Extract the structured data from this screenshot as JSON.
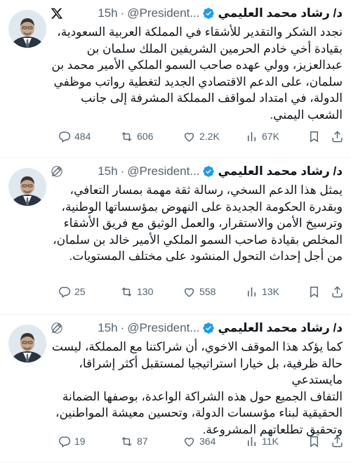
{
  "tweets": [
    {
      "author": {
        "name": "د/ رشاد محمد العليمي",
        "handle": "@President...",
        "time": "15h"
      },
      "show_x_logo": true,
      "show_edited": false,
      "paragraphs": [
        "نجدد الشكر والتقدير للأشقاء في المملكة العربية السعودية، بقيادة أخي خادم الحرمين الشريفين الملك سلمان بن عبدالعزيز، وولي عهده صاحب السمو الملكي الأمير محمد بن سلمان، على الدعم الاقتصادي الجديد لتغطية رواتب موظفي الدولة، في امتداد لمواقف المملكة المشرفة إلى جانب الشعب اليمني."
      ],
      "stats": {
        "replies": "484",
        "reposts": "606",
        "likes": "2.2K",
        "views": "67K"
      }
    },
    {
      "author": {
        "name": "د/ رشاد محمد العليمي",
        "handle": "@President...",
        "time": "15h"
      },
      "show_x_logo": false,
      "show_edited": true,
      "paragraphs": [
        "يمثل هذا الدعم السخي، رسالة ثقة مهمة بمسار التعافي، وبقدرة الحكومة الجديدة على النهوض بمؤسساتها الوطنية، وترسيخ الأمن والاستقرار، والعمل الوثيق مع فريق الأشقاء المخلص بقيادة صاحب السمو الملكي الأمير خالد بن سلمان، من أجل إحداث التحول المنشود على مختلف المستويات."
      ],
      "stats": {
        "replies": "25",
        "reposts": "130",
        "likes": "558",
        "views": "13K"
      }
    },
    {
      "author": {
        "name": "د/ رشاد محمد العليمي",
        "handle": "@President...",
        "time": "15h"
      },
      "show_x_logo": false,
      "show_edited": true,
      "paragraphs": [
        "كما يؤكد هذا الموقف الاخوي، أن شراكتنا مع المملكة، ليست حالة ظرفية، بل خيارا استراتيجيا لمستقبل أكثر إشراقا، مايستدعي",
        "التفاف الجميع حول هذه الشراكة الواعدة، بوصفها الضمانة الحقيقية لبناء مؤسسات الدولة، وتحسين معيشة المواطنين، وتحقيق تطلعاتهم المشروعة."
      ],
      "stats": {
        "replies": "19",
        "reposts": "87",
        "likes": "364",
        "views": "11K"
      }
    }
  ],
  "colors": {
    "text": "#0f1419",
    "muted": "#536471",
    "verified": "#1d9bf0",
    "divider": "#eff3f4"
  },
  "icons": [
    "x-logo-icon",
    "verified-icon",
    "edited-icon",
    "reply-icon",
    "repost-icon",
    "like-icon",
    "views-icon",
    "bookmark-icon",
    "share-icon"
  ]
}
